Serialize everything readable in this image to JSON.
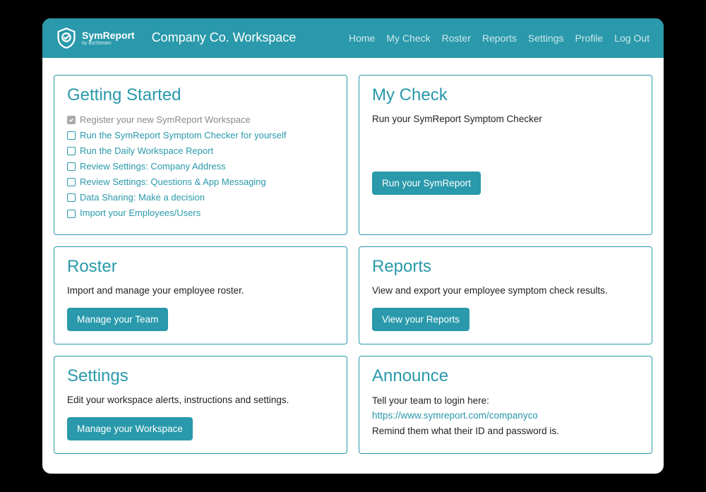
{
  "logo": {
    "name": "SymReport",
    "sub": "by BizStream"
  },
  "header": {
    "title": "Company Co. Workspace"
  },
  "nav": {
    "home": "Home",
    "mycheck": "My Check",
    "roster": "Roster",
    "reports": "Reports",
    "settings": "Settings",
    "profile": "Profile",
    "logout": "Log Out"
  },
  "getting_started": {
    "title": "Getting Started",
    "items": [
      {
        "label": "Register your new SymReport Workspace",
        "done": true
      },
      {
        "label": "Run the SymReport Symptom Checker for yourself",
        "done": false
      },
      {
        "label": "Run the Daily Workspace Report",
        "done": false
      },
      {
        "label": "Review Settings: Company Address",
        "done": false
      },
      {
        "label": "Review Settings: Questions & App Messaging",
        "done": false
      },
      {
        "label": "Data Sharing: Make a decision",
        "done": false
      },
      {
        "label": "Import your Employees/Users",
        "done": false
      }
    ]
  },
  "my_check": {
    "title": "My Check",
    "desc": "Run your SymReport Symptom Checker",
    "button": "Run your SymReport"
  },
  "roster": {
    "title": "Roster",
    "desc": "Import and manage your employee roster.",
    "button": "Manage your Team"
  },
  "reports": {
    "title": "Reports",
    "desc": "View and export your employee symptom check results.",
    "button": "View your Reports"
  },
  "settings": {
    "title": "Settings",
    "desc": "Edit your workspace alerts, instructions and settings.",
    "button": "Manage your Workspace"
  },
  "announce": {
    "title": "Announce",
    "intro": "Tell your team to login here:",
    "url": "https://www.symreport.com/companyco",
    "remind": "Remind them what their ID and password is."
  }
}
